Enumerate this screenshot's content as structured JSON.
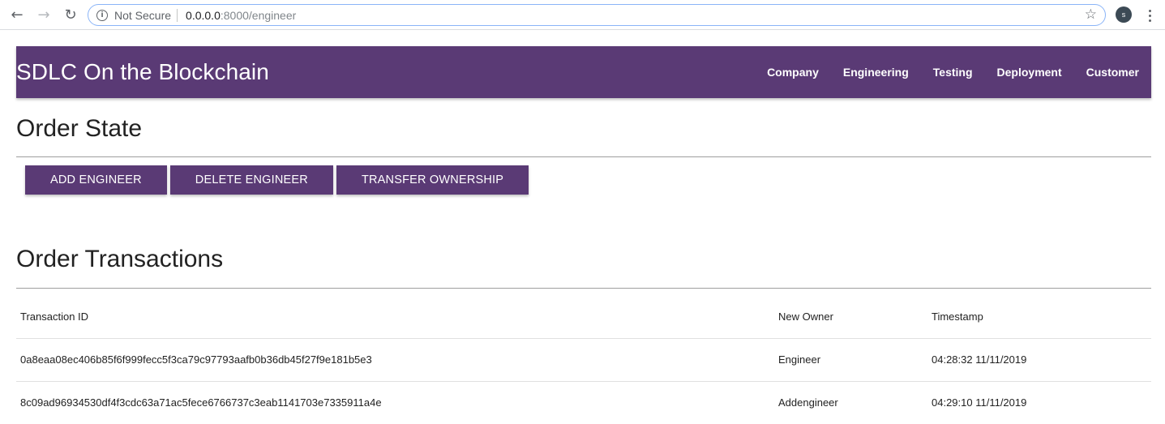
{
  "browser": {
    "back_glyph": "←",
    "forward_glyph": "→",
    "reload_glyph": "↻",
    "info_glyph": "i",
    "security_label": "Not Secure",
    "url_host": "0.0.0.0",
    "url_rest": ":8000/engineer",
    "star_glyph": "☆",
    "profile_initial": "s"
  },
  "header": {
    "title": "SDLC On the Blockchain",
    "nav": [
      "Company",
      "Engineering",
      "Testing",
      "Deployment",
      "Customer"
    ]
  },
  "order_state": {
    "title": "Order State",
    "buttons": [
      "ADD ENGINEER",
      "DELETE ENGINEER",
      "TRANSFER OWNERSHIP"
    ]
  },
  "transactions": {
    "title": "Order Transactions",
    "columns": [
      "Transaction ID",
      "New Owner",
      "Timestamp"
    ],
    "rows": [
      {
        "id": "0a8eaa08ec406b85f6f999fecc5f3ca79c97793aafb0b36db45f27f9e181b5e3",
        "owner": "Engineer",
        "timestamp": "04:28:32 11/11/2019"
      },
      {
        "id": "8c09ad96934530df4f3cdc63a71ac5fece6766737c3eab1141703e7335911a4e",
        "owner": "Addengineer",
        "timestamp": "04:29:10 11/11/2019"
      }
    ]
  },
  "colors": {
    "brand_purple": "#5a3a75",
    "rule_gray": "#9e9e9e",
    "focus_blue": "#8ab4f8"
  }
}
